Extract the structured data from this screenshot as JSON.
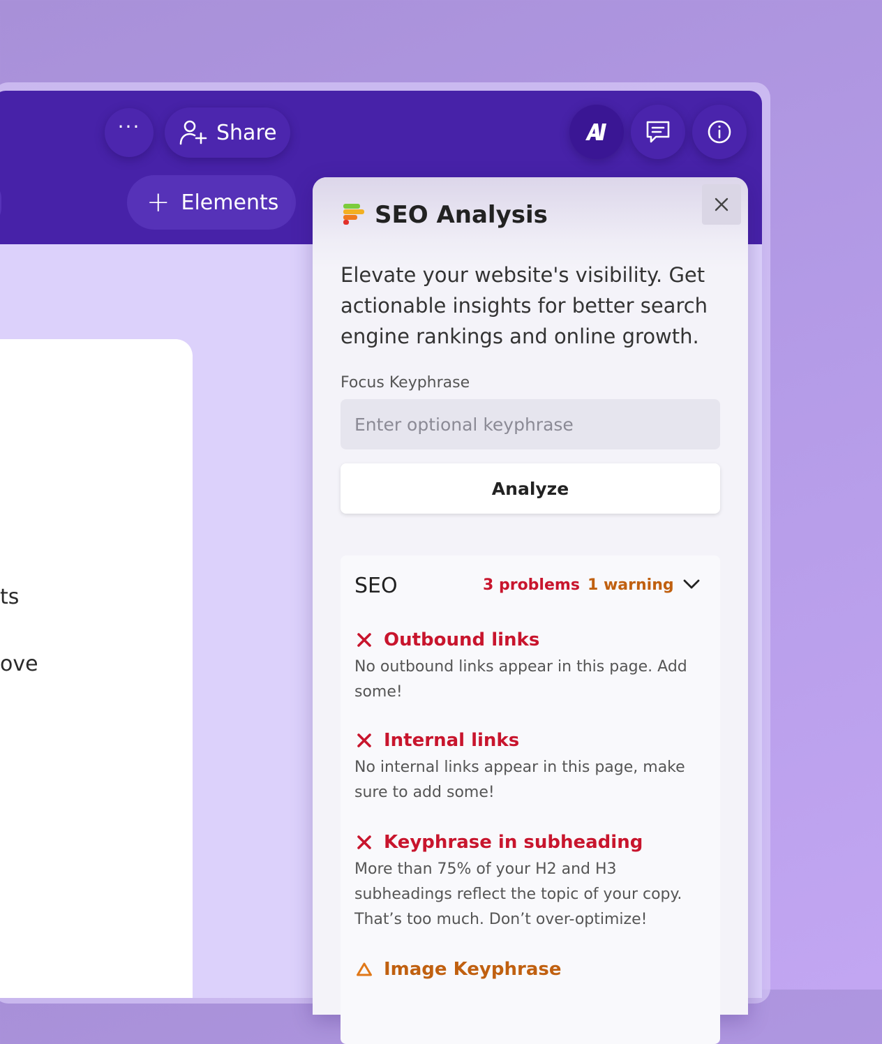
{
  "toolbar": {
    "more_label": "···",
    "share_label": "Share",
    "elements_label": "Elements"
  },
  "canvas": {
    "fragment_1": "ts",
    "fragment_2": "ove"
  },
  "seo_panel": {
    "title": "SEO Analysis",
    "description": "Elevate your website's visibility. Get actionable insights for better search engine rankings and online growth.",
    "keyphrase_label": "Focus Keyphrase",
    "keyphrase_placeholder": "Enter optional keyphrase",
    "keyphrase_value": "",
    "analyze_label": "Analyze",
    "section": {
      "title": "SEO",
      "problems": "3 problems",
      "warnings": "1 warning"
    },
    "items": [
      {
        "status": "problem",
        "title": "Outbound links",
        "description": "No outbound links appear in this page. Add some!"
      },
      {
        "status": "problem",
        "title": "Internal links",
        "description": "No internal links appear in this page, make sure to add some!"
      },
      {
        "status": "problem",
        "title": "Keyphrase in subheading",
        "description": "More than 75% of your H2 and H3 subheadings reflect the topic of your copy. That’s too much. Don’t over-optimize!"
      },
      {
        "status": "warning",
        "title": "Image Keyphrase",
        "description": ""
      }
    ]
  },
  "colors": {
    "toolbar_bg": "#4722a8",
    "problem": "#c8152d",
    "warning": "#c06010",
    "panel_bg": "#f4f3f9"
  },
  "icons": {
    "more": "more-dots-icon",
    "share": "add-user-icon",
    "ai": "ai-icon",
    "comments": "comment-icon",
    "info": "info-icon",
    "close": "close-icon",
    "problem": "x-icon",
    "warning": "warning-triangle-icon",
    "collapse": "chevron-down-icon"
  }
}
